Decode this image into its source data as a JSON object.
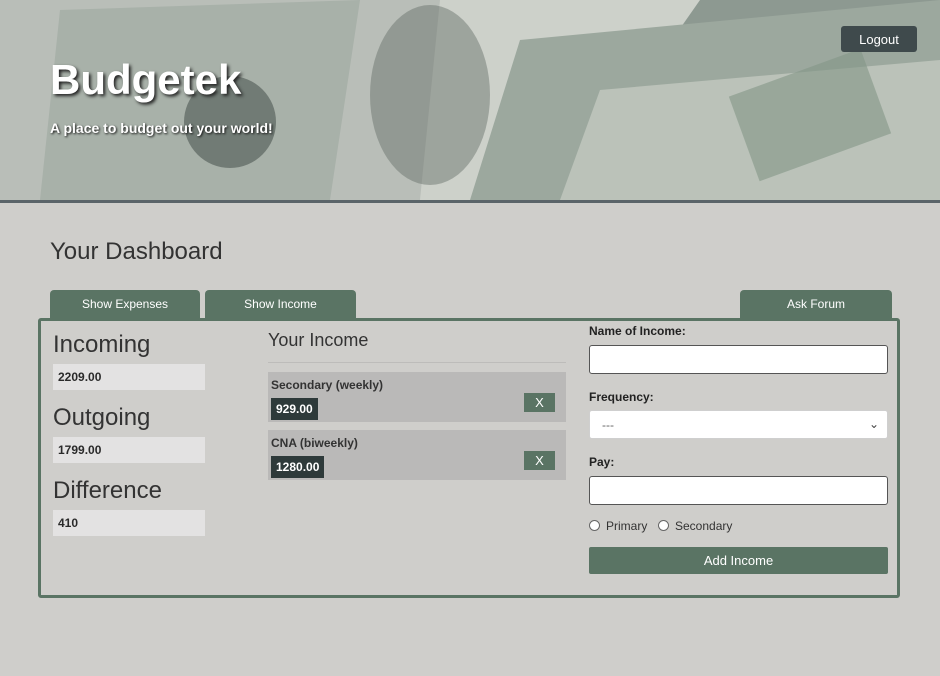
{
  "header": {
    "brand": "Budgetek",
    "tagline": "A place to budget out your world!",
    "logout_label": "Logout"
  },
  "dashboard": {
    "title": "Your Dashboard",
    "tabs": {
      "expenses": "Show Expenses",
      "income": "Show Income",
      "forum": "Ask Forum"
    }
  },
  "summary": {
    "incoming_label": "Incoming",
    "incoming_value": "2209.00",
    "outgoing_label": "Outgoing",
    "outgoing_value": "1799.00",
    "difference_label": "Difference",
    "difference_value": "410"
  },
  "income": {
    "title": "Your Income",
    "items": [
      {
        "name": "Secondary (weekly)",
        "amount": "929.00",
        "delete_label": "X"
      },
      {
        "name": "CNA (biweekly)",
        "amount": "1280.00",
        "delete_label": "X"
      }
    ]
  },
  "form": {
    "name_label": "Name of Income:",
    "name_value": "",
    "frequency_label": "Frequency:",
    "frequency_value": "---",
    "pay_label": "Pay:",
    "pay_value": "",
    "radio_primary": "Primary",
    "radio_secondary": "Secondary",
    "submit_label": "Add Income"
  },
  "colors": {
    "accent": "#5a7464",
    "background": "#cfcecb",
    "logout_bg": "#3f4a4c"
  }
}
